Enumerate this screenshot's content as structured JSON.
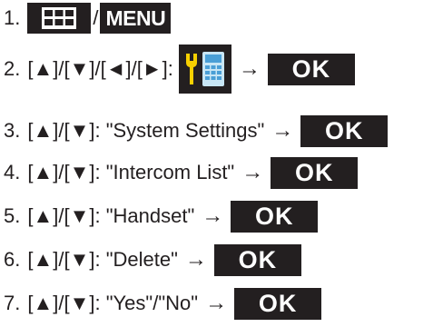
{
  "steps": [
    {
      "number": "1.",
      "separator": "/",
      "menu_key_label": "MENU",
      "grid_icon": "grid-menu-icon"
    },
    {
      "number": "2.",
      "text": "[▲]/[▼]/[◄]/[►]:",
      "icon": "settings-phone-icon",
      "arrow": "→",
      "ok_label": "OK"
    },
    {
      "number": "3.",
      "text": "[▲]/[▼]: \"System Settings\"",
      "arrow": "→",
      "ok_label": "OK"
    },
    {
      "number": "4.",
      "text": "[▲]/[▼]: \"Intercom List\"",
      "arrow": "→",
      "ok_label": "OK"
    },
    {
      "number": "5.",
      "text": "[▲]/[▼]: \"Handset\"",
      "arrow": "→",
      "ok_label": "OK"
    },
    {
      "number": "6.",
      "text": "[▲]/[▼]: \"Delete\"",
      "arrow": "→",
      "ok_label": "OK"
    },
    {
      "number": "7.",
      "text": "[▲]/[▼]: \"Yes\"/\"No\"",
      "arrow": "→",
      "ok_label": "OK"
    }
  ],
  "colors": {
    "ink": "#231f20",
    "key_background": "#231f20",
    "key_text": "#ffffff"
  }
}
